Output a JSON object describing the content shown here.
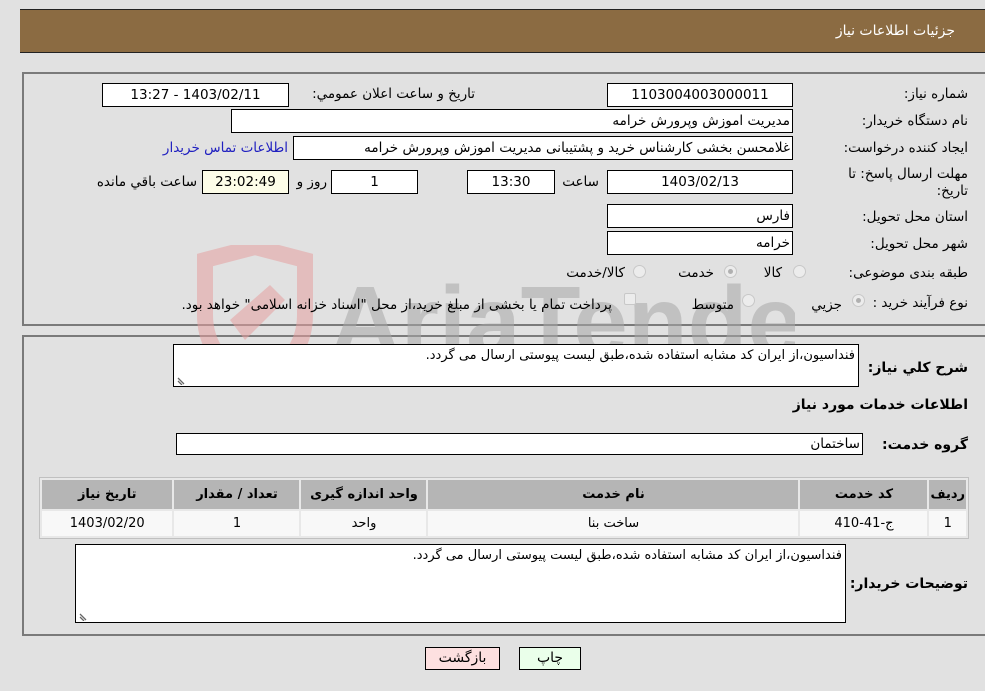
{
  "header": {
    "title": "جزئیات اطلاعات نیاز"
  },
  "form": {
    "need_number": {
      "label": "شماره نیاز:",
      "value": "1103004003000011"
    },
    "announce_datetime": {
      "label": "تاریخ و ساعت اعلان عمومي:",
      "value": "1403/02/11 - 13:27"
    },
    "buyer_org": {
      "label": "نام دستگاه خریدار:",
      "value": "مدیریت اموزش وپرورش خرامه"
    },
    "requester": {
      "label": "ایجاد کننده درخواست:",
      "value": "غلامحسن بخشی کارشناس خرید و پشتیبانی مدیریت اموزش وپرورش خرامه"
    },
    "buyer_contact_link": "اطلاعات تماس خریدار",
    "deadline": {
      "label": "مهلت ارسال پاسخ: تا تاریخ:",
      "date": "1403/02/13",
      "time_label": "ساعت",
      "time": "13:30",
      "days": "1",
      "days_label": "روز و",
      "remaining": "23:02:49",
      "remaining_label": "ساعت باقي مانده"
    },
    "province": {
      "label": "استان محل تحویل:",
      "value": "فارس"
    },
    "city": {
      "label": "شهر محل تحویل:",
      "value": "خرامه"
    },
    "category": {
      "label": "طبقه بندی موضوعی:",
      "options": [
        "کالا",
        "خدمت",
        "کالا/خدمت"
      ],
      "selected": "خدمت"
    },
    "purchase_type": {
      "label": "نوع فرآیند خرید :",
      "options": [
        "جزيي",
        "متوسط"
      ],
      "selected": "جزيي",
      "treasury_note": "پرداخت تمام یا بخشی از مبلغ خرید،از محل \"اسناد خزانه اسلامی\" خواهد بود."
    }
  },
  "details": {
    "description_label": "شرح كلي نیاز:",
    "description": "فنداسیون،از ایران کد مشابه استفاده شده،طبق لیست پیوستی ارسال می گردد.",
    "services_heading": "اطلاعات خدمات مورد نیاز",
    "service_group_label": "گروه خدمت:",
    "service_group": "ساختمان",
    "table": {
      "headers": [
        "ردیف",
        "کد خدمت",
        "نام خدمت",
        "واحد اندازه گیری",
        "تعداد / مقدار",
        "تاریخ نیاز"
      ],
      "rows": [
        [
          "1",
          "ج-41-410",
          "ساخت بنا",
          "واحد",
          "1",
          "1403/02/20"
        ]
      ]
    },
    "buyer_notes_label": "توضیحات خریدار:",
    "buyer_notes": "فنداسیون،از ایران کد مشابه استفاده شده،طبق لیست پیوستی ارسال می گردد."
  },
  "buttons": {
    "print": "چاپ",
    "back": "بازگشت"
  },
  "watermark": {
    "text": "AriaTender.neT"
  }
}
